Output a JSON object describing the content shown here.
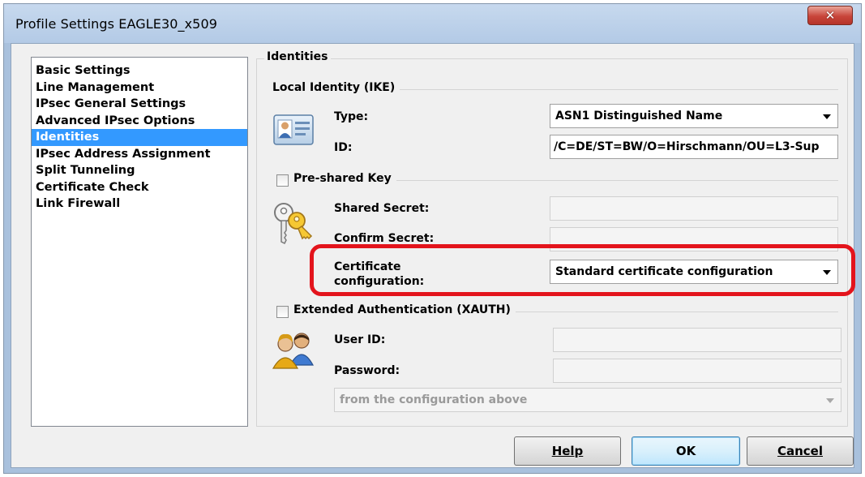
{
  "window": {
    "title": "Profile Settings  EAGLE30_x509",
    "close_glyph": "✕"
  },
  "nav": {
    "items": [
      {
        "label": "Basic Settings"
      },
      {
        "label": "Line Management"
      },
      {
        "label": "IPsec General Settings"
      },
      {
        "label": "Advanced IPsec Options"
      },
      {
        "label": "Identities"
      },
      {
        "label": "IPsec Address Assignment"
      },
      {
        "label": "Split Tunneling"
      },
      {
        "label": "Certificate Check"
      },
      {
        "label": "Link Firewall"
      }
    ],
    "selected": "Identities"
  },
  "identities": {
    "group_title": "Identities",
    "local_identity": {
      "section_label": "Local Identity (IKE)",
      "type_label": "Type:",
      "type_value": "ASN1 Distinguished Name",
      "id_label": "ID:",
      "id_value": "/C=DE/ST=BW/O=Hirschmann/OU=L3-Sup"
    },
    "psk": {
      "checkbox_label": "Pre-shared Key",
      "checked": false,
      "shared_secret_label": "Shared Secret:",
      "confirm_secret_label": "Confirm Secret:",
      "cert_config_label_line1": "Certificate",
      "cert_config_label_line2": "configuration:",
      "cert_config_value": "Standard certificate configuration"
    },
    "xauth": {
      "checkbox_label": "Extended Authentication (XAUTH)",
      "checked": false,
      "user_id_label": "User ID:",
      "password_label": "Password:",
      "source_value": "from the configuration above"
    }
  },
  "buttons": {
    "help": "Help",
    "ok": "OK",
    "cancel": "Cancel"
  },
  "colors": {
    "selection": "#3399ff",
    "highlight_ring": "#e3141c",
    "title_bar": "#b9cfe9",
    "close_button": "#c8453a"
  }
}
